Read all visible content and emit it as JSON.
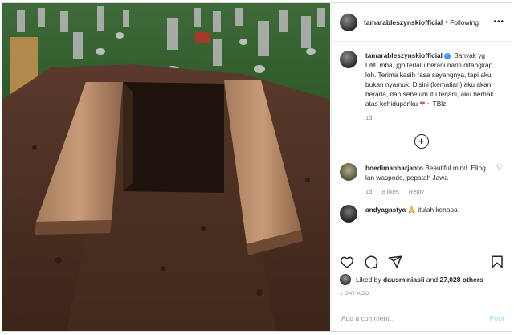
{
  "header": {
    "username": "tamarableszynskiofficial",
    "follow_label": "Following",
    "more_icon": "more-horizontal-icon"
  },
  "caption": {
    "username": "tamarableszynskiofficial",
    "text": "Banyak yg DM..mba, jgn terlalu berani nanti ditangkap loh. Terima kasih rasa sayangnya, tapi aku bukan nyamuk. Disini (kematian) aku akan berada, dan sebelum itu terjadi, aku berhak atas kehidupanku",
    "emoji": "❤",
    "signoff": "~ TBlz",
    "time": "1d"
  },
  "load_more_icon": "plus-circle-icon",
  "comments": [
    {
      "username": "boedimanharjanto",
      "text": "Beautiful mind. Eling lan waspodo, pepatah Jawa",
      "time": "1d",
      "likes": "8 likes",
      "reply": "Reply"
    },
    {
      "username": "andyagastya",
      "text": "🙏 itulah kenapa",
      "time": "",
      "likes": "",
      "reply": ""
    }
  ],
  "actions": [
    "heart-icon",
    "comment-icon",
    "share-icon",
    "bookmark-icon"
  ],
  "likes": {
    "prefix": "Liked by",
    "user": "dausminiasli",
    "middle": "and",
    "count": "27,028 others"
  },
  "timestamp": "1 DAY AGO",
  "add_comment": {
    "placeholder": "Add a comment...",
    "post_label": "Post"
  },
  "colors": {
    "verified": "#3897f0",
    "heart": "#ed4956",
    "post_disabled": "#b2dffc"
  }
}
